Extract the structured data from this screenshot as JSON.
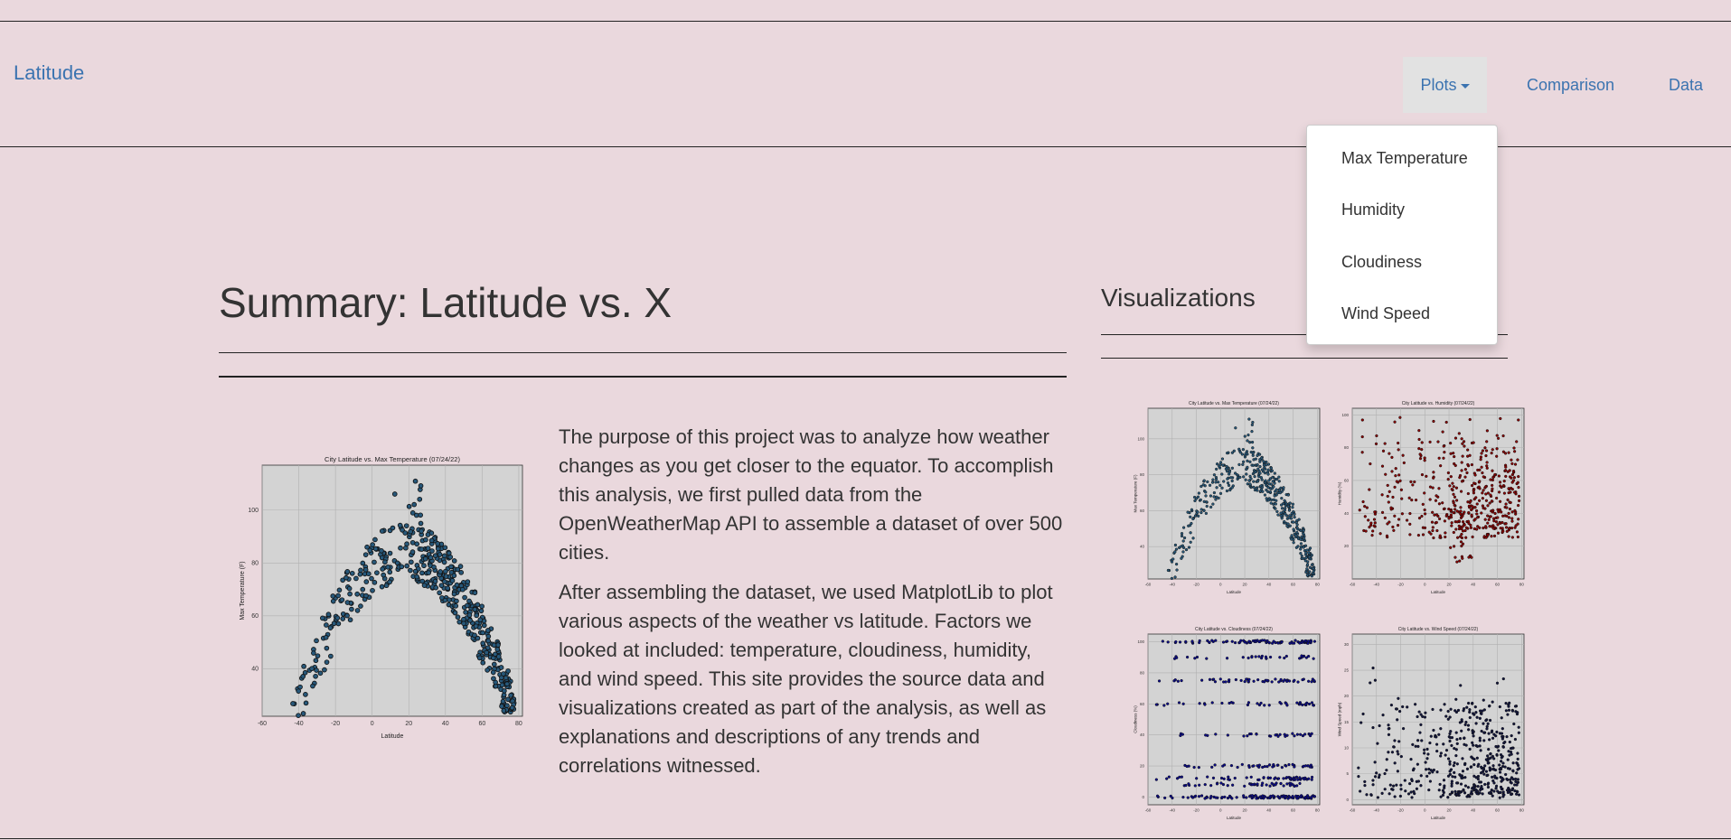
{
  "navbar": {
    "brand": "Latitude",
    "plots_label": "Plots",
    "comparison_label": "Comparison",
    "data_label": "Data"
  },
  "dropdown": {
    "items": [
      "Max Temperature",
      "Humidity",
      "Cloudiness",
      "Wind Speed"
    ]
  },
  "summary": {
    "title": "Summary: Latitude vs. X",
    "paragraph1": "The purpose of this project was to analyze how weather changes as you get closer to the equator. To accomplish this analysis, we first pulled data from the OpenWeatherMap API to assemble a dataset of over 500 cities.",
    "paragraph2": "After assembling the dataset, we used MatplotLib to plot various aspects of the weather vs latitude. Factors we looked at included: temperature, cloudiness, humidity, and wind speed. This site provides the source data and visualizations created as part of the analysis, as well as explanations and descriptions of any trends and correlations witnessed."
  },
  "visualizations": {
    "title": "Visualizations"
  },
  "colors": {
    "background": "#ead8dd",
    "link": "#3b73b0",
    "plot_face": "#d3d3d3",
    "temp_marker": "#27587a",
    "humidity_marker": "#8b0000",
    "cloud_marker": "#0a0a8a",
    "wind_marker": "#12163e"
  },
  "chart_data": [
    {
      "id": "main-temp",
      "type": "scatter",
      "title": "City Latitude vs. Max Temperature (07/24/22)",
      "xlabel": "Latitude",
      "ylabel": "Max Temperature (F)",
      "xlim": [
        -60,
        82
      ],
      "ylim": [
        22,
        117
      ],
      "xticks": [
        -60,
        -40,
        -20,
        0,
        20,
        40,
        60,
        80
      ],
      "yticks": [
        40,
        60,
        80,
        100
      ],
      "grid": true,
      "series": [
        {
          "marker": "temp_marker",
          "x": [],
          "y": [],
          "pattern": "temperature"
        }
      ]
    },
    {
      "id": "thumb-temp",
      "type": "scatter",
      "title": "City Latitude vs. Max Temperature (07/24/22)",
      "xlabel": "Latitude",
      "ylabel": "Max Temperature (F)",
      "xlim": [
        -60,
        82
      ],
      "ylim": [
        22,
        117
      ],
      "xticks": [
        -60,
        -40,
        -20,
        0,
        20,
        40,
        60,
        80
      ],
      "yticks": [
        40,
        60,
        80,
        100
      ],
      "grid": true,
      "series": [
        {
          "marker": "temp_marker",
          "pattern": "temperature"
        }
      ]
    },
    {
      "id": "thumb-humidity",
      "type": "scatter",
      "title": "City Latitude vs. Humidity (07/24/22)",
      "xlabel": "Latitude",
      "ylabel": "Humidity (%)",
      "xlim": [
        -60,
        82
      ],
      "ylim": [
        0,
        104
      ],
      "xticks": [
        -60,
        -40,
        -20,
        0,
        20,
        40,
        60,
        80
      ],
      "yticks": [
        20,
        40,
        60,
        80,
        100
      ],
      "grid": true,
      "series": [
        {
          "marker": "humidity_marker",
          "pattern": "humidity"
        }
      ]
    },
    {
      "id": "thumb-cloud",
      "type": "scatter",
      "title": "City Latitude vs. Cloudiness (07/24/22)",
      "xlabel": "Latitude",
      "ylabel": "Cloudiness (%)",
      "xlim": [
        -60,
        82
      ],
      "ylim": [
        -5,
        105
      ],
      "xticks": [
        -60,
        -40,
        -20,
        0,
        20,
        40,
        60,
        80
      ],
      "yticks": [
        0,
        20,
        40,
        60,
        80,
        100
      ],
      "grid": true,
      "series": [
        {
          "marker": "cloud_marker",
          "pattern": "cloudiness"
        }
      ]
    },
    {
      "id": "thumb-wind",
      "type": "scatter",
      "title": "City Latitude vs. Wind Speed (07/24/22)",
      "xlabel": "Latitude",
      "ylabel": "Wind Speed (mph)",
      "xlim": [
        -60,
        82
      ],
      "ylim": [
        -1,
        32
      ],
      "xticks": [
        -60,
        -40,
        -20,
        0,
        20,
        40,
        60,
        80
      ],
      "yticks": [
        0,
        5,
        10,
        15,
        20,
        25,
        30
      ],
      "grid": true,
      "series": [
        {
          "marker": "wind_marker",
          "pattern": "wind"
        }
      ]
    }
  ]
}
